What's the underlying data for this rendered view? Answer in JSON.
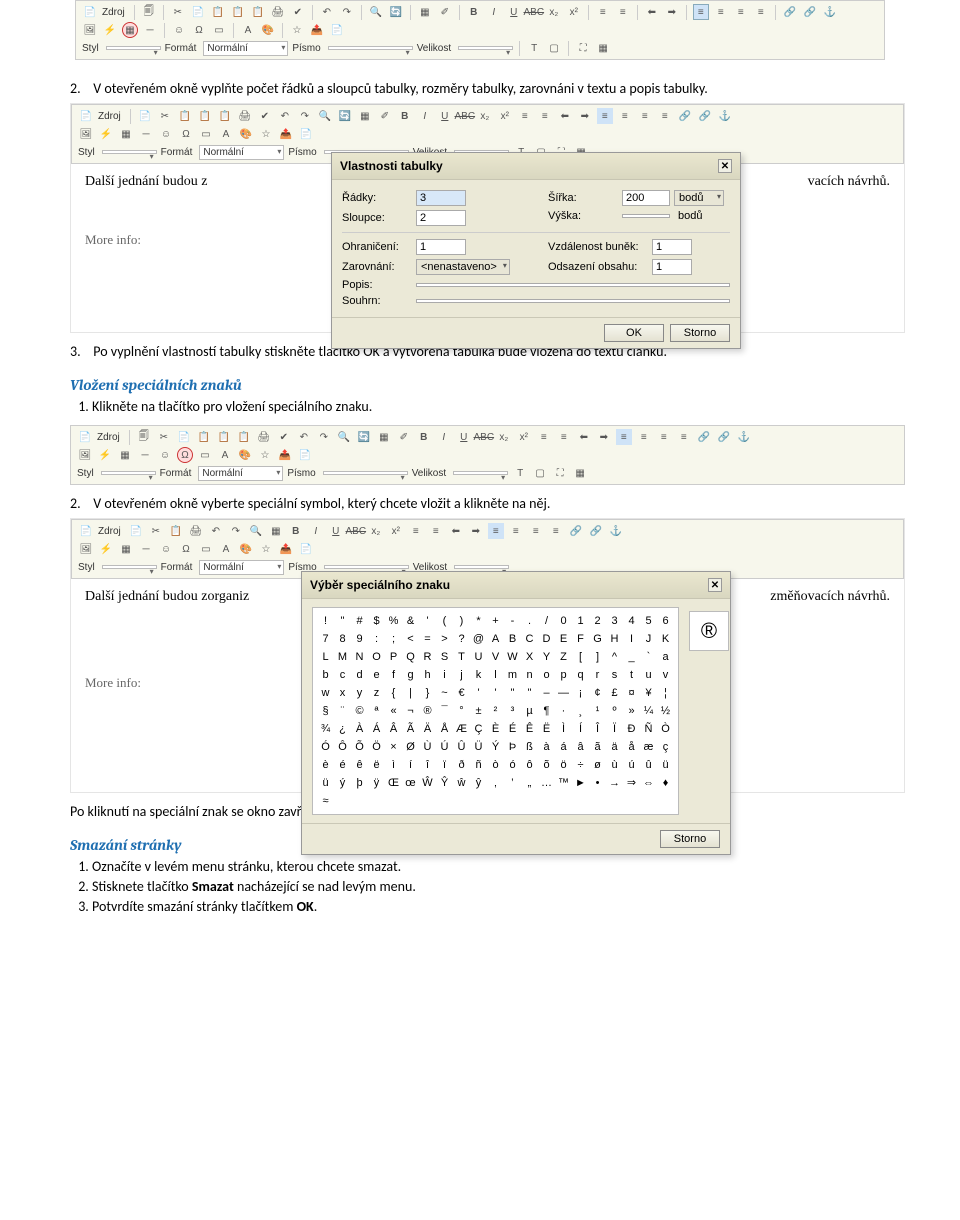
{
  "toolbar": {
    "source_label": "Zdroj",
    "style_label": "Styl",
    "format_label": "Formát",
    "format_value": "Normální",
    "font_label": "Písmo",
    "size_label": "Velikost",
    "icons": [
      "📄",
      "📋",
      "✂",
      "📄",
      "📋",
      "📋",
      "🖨",
      "✔",
      "↶",
      "↷",
      "🔍",
      "🔄",
      "🎨",
      "✐",
      "B",
      "I",
      "U",
      "ABC",
      "x₂",
      "x²",
      "≡",
      "≡",
      "≡",
      "⬅",
      "⬌",
      "➡",
      "≡",
      "🔗",
      "🔗",
      "⚓"
    ],
    "icons_row2": [
      "🖼",
      "🗖",
      "—",
      "☺",
      "🧊",
      "📊",
      "🗔",
      "🎨",
      "☆",
      "📤",
      "📄"
    ]
  },
  "steps": {
    "s2": "V otevřeném okně vyplňte počet řádků a sloupců tabulky, rozměry tabulky, zarovnáni v textu a popis tabulky.",
    "s3": "Po vyplnění vlastností tabulky stiskněte tlačítko OK a vytvořená tabulka bude vložena do textu článku.",
    "sec_special": "Vložení speciálních znaků",
    "sp1": "Klikněte na tlačítko pro vložení speciálního znaku.",
    "sp2": "V otevřeném okně vyberte speciální symbol, který chcete vložit a klikněte na něj.",
    "sp_after": "Po kliknutí na speciální znak se okno zavře a znak bude vložen do textu.",
    "sec_delete": "Smazání stránky",
    "d1": "Označíte v levém menu stránku, kterou chcete smazat.",
    "d2_a": "Stisknete tlačítko ",
    "d2_b": "Smazat",
    "d2_c": " nacházející se nad levým menu.",
    "d3_a": "Potvrdíte smazání stránky tlačítkem ",
    "d3_b": "OK",
    "d3_c": "."
  },
  "editor": {
    "line1_a": "Další jednání budou z",
    "line1_b": "vacích návrhů.",
    "line1_c": "Další jednání budou zorganiz",
    "line1_d": "změňovacích návrhů.",
    "more": "More info:"
  },
  "dlg_table": {
    "title": "Vlastnosti tabulky",
    "rows_lbl": "Řádky:",
    "rows_val": "3",
    "cols_lbl": "Sloupce:",
    "cols_val": "2",
    "width_lbl": "Šířka:",
    "width_val": "200",
    "width_unit": "bodů",
    "height_lbl": "Výška:",
    "height_unit": "bodů",
    "border_lbl": "Ohraničení:",
    "border_val": "1",
    "cellspace_lbl": "Vzdálenost buněk:",
    "cellspace_val": "1",
    "align_lbl": "Zarovnání:",
    "align_val": "<nenastaveno>",
    "cellpad_lbl": "Odsazení obsahu:",
    "cellpad_val": "1",
    "caption_lbl": "Popis:",
    "summary_lbl": "Souhrn:",
    "ok": "OK",
    "cancel": "Storno"
  },
  "dlg_char": {
    "title": "Výběr speciálního znaku",
    "preview": "®",
    "cancel": "Storno",
    "chars": [
      "!",
      "\"",
      "#",
      "$",
      "%",
      "&",
      "'",
      "(",
      ")",
      "*",
      "+",
      "-",
      ".",
      "/",
      "0",
      "1",
      "2",
      "3",
      "4",
      "5",
      "6",
      "7",
      "8",
      "9",
      ":",
      ";",
      "<",
      "=",
      ">",
      "?",
      "@",
      "A",
      "B",
      "C",
      "D",
      "E",
      "F",
      "G",
      "H",
      "I",
      "J",
      "K",
      "L",
      "M",
      "N",
      "O",
      "P",
      "Q",
      "R",
      "S",
      "T",
      "U",
      "V",
      "W",
      "X",
      "Y",
      "Z",
      "[",
      "]",
      "^",
      "_",
      "`",
      "a",
      "b",
      "c",
      "d",
      "e",
      "f",
      "g",
      "h",
      "i",
      "j",
      "k",
      "l",
      "m",
      "n",
      "o",
      "p",
      "q",
      "r",
      "s",
      "t",
      "u",
      "v",
      "w",
      "x",
      "y",
      "z",
      "{",
      "|",
      "}",
      "~",
      "€",
      "'",
      "'",
      "\"",
      "\"",
      "–",
      "—",
      "¡",
      "¢",
      "£",
      "¤",
      "¥",
      "¦",
      "§",
      "¨",
      "©",
      "ª",
      "«",
      "¬",
      "®",
      "¯",
      "°",
      "±",
      "²",
      "³",
      "µ",
      "¶",
      "·",
      "¸",
      "¹",
      "º",
      "»",
      "¼",
      "½",
      "¾",
      "¿",
      "À",
      "Á",
      "Â",
      "Ã",
      "Ä",
      "Å",
      "Æ",
      "Ç",
      "È",
      "É",
      "Ê",
      "Ë",
      "Ì",
      "Í",
      "Î",
      "Ï",
      "Ð",
      "Ñ",
      "Ò",
      "Ó",
      "Ô",
      "Õ",
      "Ö",
      "×",
      "Ø",
      "Ù",
      "Ú",
      "Û",
      "Ü",
      "Ý",
      "Þ",
      "ß",
      "à",
      "á",
      "â",
      "ã",
      "ä",
      "å",
      "æ",
      "ç",
      "è",
      "é",
      "ê",
      "ë",
      "ì",
      "í",
      "î",
      "ï",
      "ð",
      "ñ",
      "ò",
      "ó",
      "ô",
      "õ",
      "ö",
      "÷",
      "ø",
      "ù",
      "ú",
      "û",
      "ü",
      "ü",
      "ý",
      "þ",
      "ÿ",
      "Œ",
      "œ",
      "Ŵ",
      "Ŷ",
      "ŵ",
      "ŷ",
      "‚",
      "‛",
      "„",
      "…",
      "™",
      "►",
      "•",
      "→",
      "⇒",
      "⇔",
      "♦",
      "≈"
    ]
  }
}
